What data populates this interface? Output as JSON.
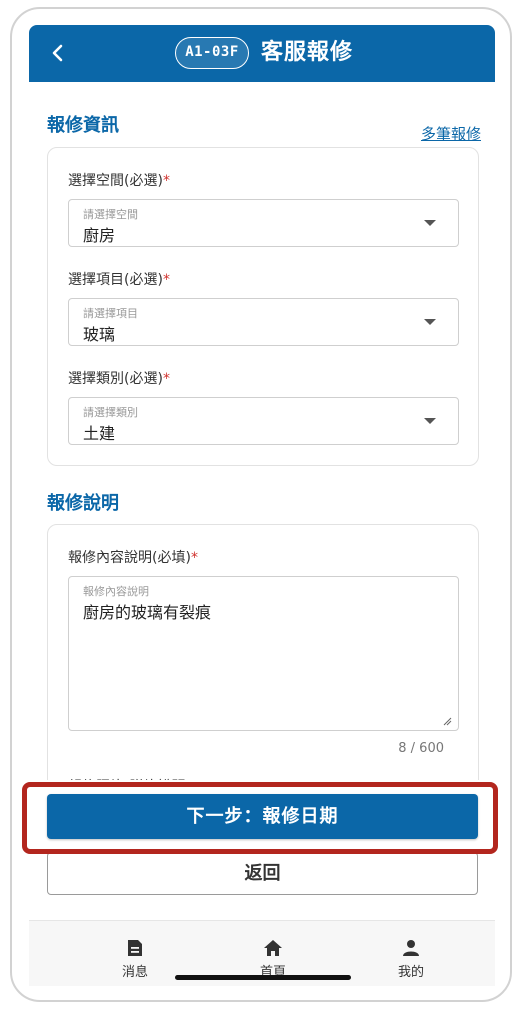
{
  "header": {
    "back_icon": "chevron-left-icon",
    "unit_badge": "A1-03F",
    "title": "客服報修",
    "color": "#0b67a8"
  },
  "repair_info": {
    "section_title": "報修資訊",
    "multi_link": "多筆報修",
    "fields": [
      {
        "label": "選擇空間(必選)",
        "required_mark": "*",
        "placeholder": "請選擇空間",
        "value": "廚房"
      },
      {
        "label": "選擇項目(必選)",
        "required_mark": "*",
        "placeholder": "請選擇項目",
        "value": "玻璃"
      },
      {
        "label": "選擇類別(必選)",
        "required_mark": "*",
        "placeholder": "請選擇類別",
        "value": "土建"
      }
    ]
  },
  "description": {
    "section_title": "報修說明",
    "label": "報修內容說明(必填)",
    "required_mark": "*",
    "placeholder": "報修內容說明",
    "value": "廚房的玻璃有裂痕",
    "counter": "8 / 600",
    "next_label_cutoff": "報修照片(附片說明)*"
  },
  "actions": {
    "next": "下一步：報修日期",
    "back": "返回",
    "highlight_color": "#b3261e"
  },
  "tabbar": {
    "items": [
      {
        "label": "消息",
        "icon": "message-icon"
      },
      {
        "label": "首頁",
        "icon": "home-icon"
      },
      {
        "label": "我的",
        "icon": "user-icon"
      }
    ]
  }
}
